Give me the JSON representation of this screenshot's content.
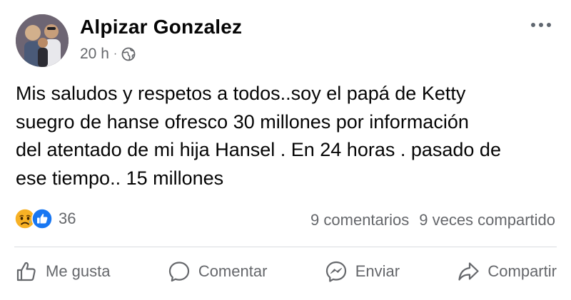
{
  "post": {
    "author": "Alpizar Gonzalez",
    "timestamp": "20 h",
    "separator": "·",
    "privacy_icon": "globe-icon",
    "more_icon": "more-options-icon",
    "text": "Mis saludos y respetos a todos..soy el papá de Ketty\nsuegro de hanse   ofresco 30 millones por información\ndel atentado de mi hija Hansel . En 24 horas . pasado de\nese tiempo.. 15 millones"
  },
  "reactions": {
    "icons": [
      "sad-reaction-icon",
      "like-reaction-icon"
    ],
    "count": "36",
    "comments": "9 comentarios",
    "shares": "9 veces compartido"
  },
  "actions": [
    {
      "label": "Me gusta",
      "icon": "thumbs-up-icon"
    },
    {
      "label": "Comentar",
      "icon": "comment-icon"
    },
    {
      "label": "Enviar",
      "icon": "messenger-icon"
    },
    {
      "label": "Compartir",
      "icon": "share-icon"
    }
  ],
  "colors": {
    "text": "#050505",
    "secondary": "#65676b",
    "like_blue": "#1877f2",
    "sad_yellow": "#f7b125",
    "divider": "#dadde1"
  }
}
